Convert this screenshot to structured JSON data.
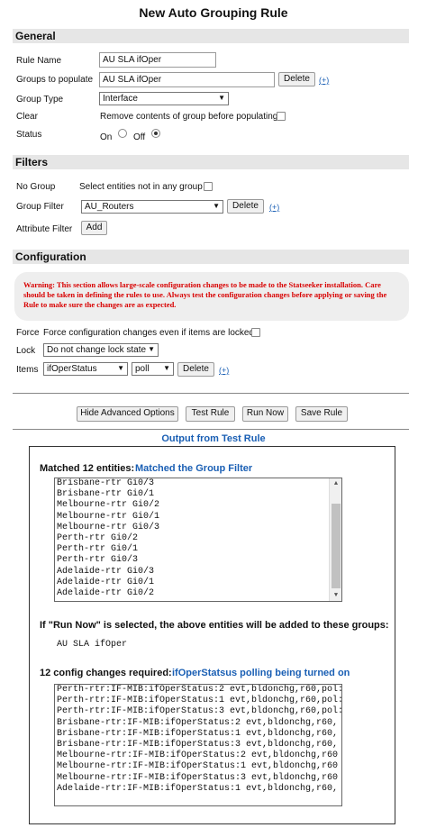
{
  "title": "New Auto Grouping Rule",
  "general": {
    "heading": "General",
    "rule_name_label": "Rule Name",
    "rule_name_value": "AU SLA ifOper",
    "groups_label": "Groups to populate",
    "groups_value": "AU SLA ifOper",
    "delete_label": "Delete",
    "plus_label": "(+)",
    "group_type_label": "Group Type",
    "group_type_value": "Interface",
    "clear_label": "Clear",
    "clear_text": "Remove contents of group before populating",
    "status_label": "Status",
    "on_label": "On",
    "off_label": "Off"
  },
  "filters": {
    "heading": "Filters",
    "no_group_label": "No Group",
    "no_group_text": "Select entities not in any group",
    "group_filter_label": "Group Filter",
    "group_filter_value": "AU_Routers",
    "delete_label": "Delete",
    "plus_label": "(+)",
    "attribute_filter_label": "Attribute Filter",
    "add_label": "Add"
  },
  "configuration": {
    "heading": "Configuration",
    "warning": "Warning: This section allows large-scale configuration changes to be made to the Statseeker installation. Care should be taken in defining the rules to use. Always test the configuration changes before applying or saving the Rule to make sure the changes are as expected.",
    "force_label": "Force",
    "force_text": "Force configuration changes even if items are locked",
    "lock_label": "Lock",
    "lock_value": "Do not change lock state",
    "items_label": "Items",
    "items_value": "ifOperStatus",
    "items_mode": "poll",
    "delete_label": "Delete",
    "plus_label": "(+)"
  },
  "buttons": {
    "hide_advanced": "Hide Advanced Options",
    "test_rule": "Test Rule",
    "run_now": "Run Now",
    "save_rule": "Save Rule"
  },
  "output": {
    "heading": "Output from Test Rule",
    "matched_label": "Matched 12 entities:",
    "matched_note": "Matched the Group Filter",
    "entities": [
      "Brisbane-rtr Gi0/3",
      "Brisbane-rtr Gi0/1",
      "Melbourne-rtr Gi0/2",
      "Melbourne-rtr Gi0/1",
      "Melbourne-rtr Gi0/3",
      "Perth-rtr Gi0/2",
      "Perth-rtr Gi0/1",
      "Perth-rtr Gi0/3",
      "Adelaide-rtr Gi0/3",
      "Adelaide-rtr Gi0/1",
      "Adelaide-rtr Gi0/2"
    ],
    "run_now_text": "If \"Run Now\" is selected, the above entities will be added to these groups:",
    "group_added": "AU SLA ifOper",
    "changes_label": "12 config changes required:",
    "changes_note": "ifOperStatsus polling being turned on",
    "changes": [
      "Perth-rtr:IF-MIB:ifOperStatus:2 evt,bldonchg,r60,pol:",
      "Perth-rtr:IF-MIB:ifOperStatus:1 evt,bldonchg,r60,pol:",
      "Perth-rtr:IF-MIB:ifOperStatus:3 evt,bldonchg,r60,pol:",
      "Brisbane-rtr:IF-MIB:ifOperStatus:2 evt,bldonchg,r60,",
      "Brisbane-rtr:IF-MIB:ifOperStatus:1 evt,bldonchg,r60,",
      "Brisbane-rtr:IF-MIB:ifOperStatus:3 evt,bldonchg,r60,",
      "Melbourne-rtr:IF-MIB:ifOperStatus:2 evt,bldonchg,r60",
      "Melbourne-rtr:IF-MIB:ifOperStatus:1 evt,bldonchg,r60",
      "Melbourne-rtr:IF-MIB:ifOperStatus:3 evt,bldonchg,r60",
      "Adelaide-rtr:IF-MIB:ifOperStatus:1 evt,bldonchg,r60,"
    ]
  },
  "colors": {
    "warning_text": "#d80000",
    "link_blue": "#1a5fb4",
    "section_bg": "#e6e6e6"
  }
}
